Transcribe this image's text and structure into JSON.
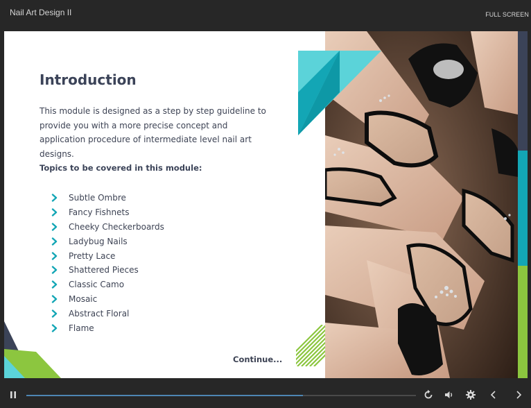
{
  "app": {
    "title": "Nail Art Design II",
    "fullscreen_label": "FULL SCREEN"
  },
  "slide": {
    "heading": "Introduction",
    "intro": "This module is designed as a step by step guideline to provide you with a more precise concept and application procedure of intermediate level nail art designs.",
    "topics_heading": "Topics to be covered in this module:",
    "topics": [
      "Subtle Ombre",
      "Fancy Fishnets",
      "Cheeky Checkerboards",
      "Ladybug Nails",
      "Pretty Lace",
      "Shattered Pieces",
      "Classic Camo",
      "Mosaic",
      "Abstract Floral",
      "Flame"
    ],
    "continue_label": "Continue..."
  },
  "player": {
    "progress": 0.71
  },
  "colors": {
    "teal_light": "#5bd3d9",
    "teal_dark": "#13a6b5",
    "navy": "#3b4358",
    "lime": "#8cc63f",
    "progress": "#4e86b3"
  },
  "icons": [
    "pause-icon",
    "replay-icon",
    "volume-icon",
    "gear-icon",
    "chevron-left-icon",
    "chevron-right-icon"
  ]
}
